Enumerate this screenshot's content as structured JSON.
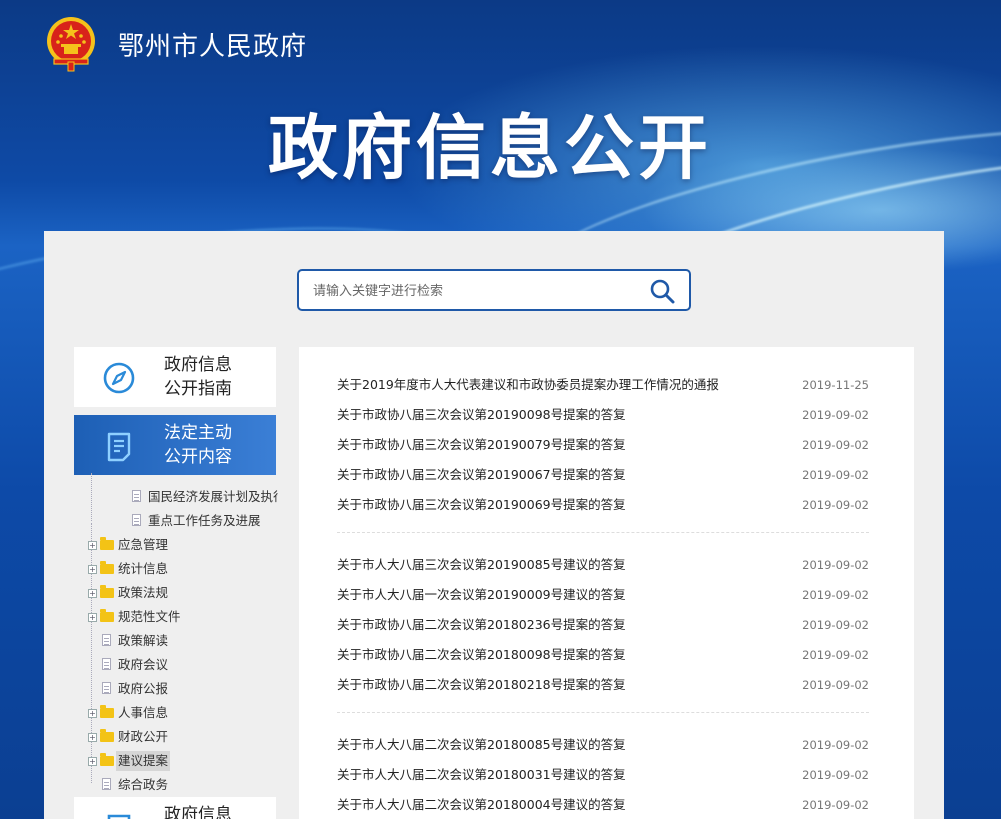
{
  "header": {
    "city_name": "鄂州市人民政府",
    "banner_title": "政府信息公开"
  },
  "search": {
    "placeholder": "请输入关键字进行检索"
  },
  "sidebar": {
    "cards": [
      {
        "line1": "政府信息",
        "line2": "公开指南",
        "icon": "compass-icon",
        "active": false
      },
      {
        "line1": "法定主动",
        "line2": "公开内容",
        "icon": "document-list-icon",
        "active": true
      },
      {
        "line1": "政府信息",
        "line2": "",
        "icon": "document-icon",
        "active": false
      }
    ],
    "tree": [
      {
        "label": "国民经济发展计划及执行",
        "type": "doc",
        "level": 2
      },
      {
        "label": "重点工作任务及进展",
        "type": "doc",
        "level": 2
      },
      {
        "label": "应急管理",
        "type": "folder",
        "level": 1
      },
      {
        "label": "统计信息",
        "type": "folder",
        "level": 1
      },
      {
        "label": "政策法规",
        "type": "folder",
        "level": 1
      },
      {
        "label": "规范性文件",
        "type": "folder",
        "level": 1
      },
      {
        "label": "政策解读",
        "type": "doc",
        "level": 1
      },
      {
        "label": "政府会议",
        "type": "doc",
        "level": 1
      },
      {
        "label": "政府公报",
        "type": "doc",
        "level": 1
      },
      {
        "label": "人事信息",
        "type": "folder",
        "level": 1
      },
      {
        "label": "财政公开",
        "type": "folder",
        "level": 1
      },
      {
        "label": "建议提案",
        "type": "folder",
        "level": 1,
        "selected": true
      },
      {
        "label": "综合政务",
        "type": "doc",
        "level": 1
      }
    ]
  },
  "news": {
    "groups": [
      [
        {
          "title": "关于2019年度市人大代表建议和市政协委员提案办理工作情况的通报",
          "date": "2019-11-25"
        },
        {
          "title": "关于市政协八届三次会议第20190098号提案的答复",
          "date": "2019-09-02"
        },
        {
          "title": "关于市政协八届三次会议第20190079号提案的答复",
          "date": "2019-09-02"
        },
        {
          "title": "关于市政协八届三次会议第20190067号提案的答复",
          "date": "2019-09-02"
        },
        {
          "title": "关于市政协八届三次会议第20190069号提案的答复",
          "date": "2019-09-02"
        }
      ],
      [
        {
          "title": "关于市人大八届三次会议第20190085号建议的答复",
          "date": "2019-09-02"
        },
        {
          "title": "关于市人大八届一次会议第20190009号建议的答复",
          "date": "2019-09-02"
        },
        {
          "title": "关于市政协八届二次会议第20180236号提案的答复",
          "date": "2019-09-02"
        },
        {
          "title": "关于市政协八届二次会议第20180098号提案的答复",
          "date": "2019-09-02"
        },
        {
          "title": "关于市政协八届二次会议第20180218号提案的答复",
          "date": "2019-09-02"
        }
      ],
      [
        {
          "title": "关于市人大八届二次会议第20180085号建议的答复",
          "date": "2019-09-02"
        },
        {
          "title": "关于市人大八届二次会议第20180031号建议的答复",
          "date": "2019-09-02"
        },
        {
          "title": "关于市人大八届二次会议第20180004号建议的答复",
          "date": "2019-09-02"
        }
      ]
    ]
  },
  "colors": {
    "primary_blue": "#1f59a8",
    "folder_yellow": "#f3c316",
    "emblem_red": "#d8231a",
    "emblem_gold": "#f5c21b"
  }
}
